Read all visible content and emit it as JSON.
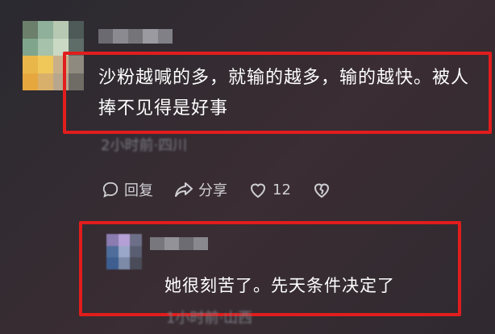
{
  "comment": {
    "text": "沙粉越喊的多，就输的越多，输的越快。被人捧不见得是好事",
    "meta": "2小时前·四川",
    "actions": {
      "reply_label": "回复",
      "share_label": "分享",
      "like_count": "12"
    }
  },
  "reply": {
    "text": "她很刻苦了。先天条件决定了",
    "meta": "1小时前·山西"
  },
  "colors": {
    "highlight_border": "#e11d1d",
    "background": "#2f2a30",
    "meta_text": "#7d7d85",
    "action_text": "#cfcfd4"
  },
  "icons": {
    "reply": "comment-bubble-icon",
    "share": "share-arrow-icon",
    "like": "heart-icon",
    "dislike": "broken-heart-icon"
  }
}
